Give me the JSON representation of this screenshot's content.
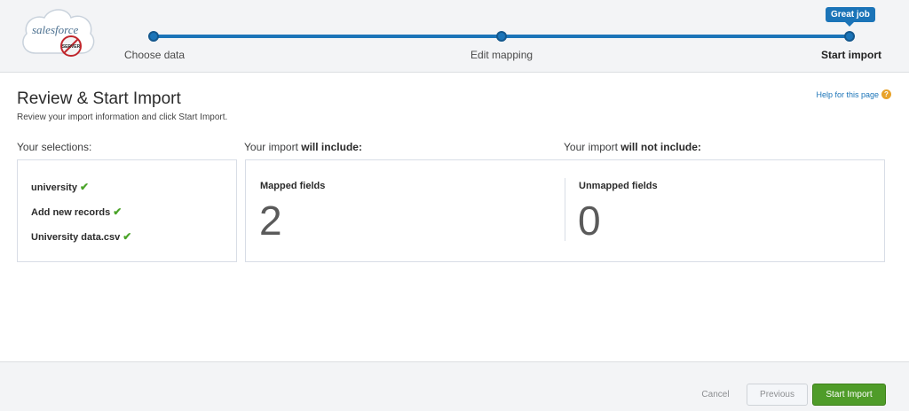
{
  "wizard": {
    "logo_text": "salesforce",
    "logo_badge": "SERVER",
    "steps": [
      "Choose data",
      "Edit mapping",
      "Start import"
    ],
    "tooltip": "Great job"
  },
  "page": {
    "title": "Review & Start Import",
    "subtitle": "Review your import information and click Start Import.",
    "help_link": "Help for this page"
  },
  "sections": {
    "selections_label": "Your selections:",
    "include_prefix": "Your import ",
    "include_bold": "will include:",
    "exclude_prefix": "Your import ",
    "exclude_bold": "will not include:"
  },
  "selections": [
    "university",
    "Add new records",
    "University data.csv"
  ],
  "stats": {
    "mapped_label": "Mapped fields",
    "mapped_value": "2",
    "unmapped_label": "Unmapped fields",
    "unmapped_value": "0"
  },
  "footer": {
    "cancel": "Cancel",
    "previous": "Previous",
    "start": "Start Import"
  },
  "colors": {
    "accent": "#1b74b8",
    "start_button": "#4f9c29",
    "check": "#4ba42a"
  }
}
